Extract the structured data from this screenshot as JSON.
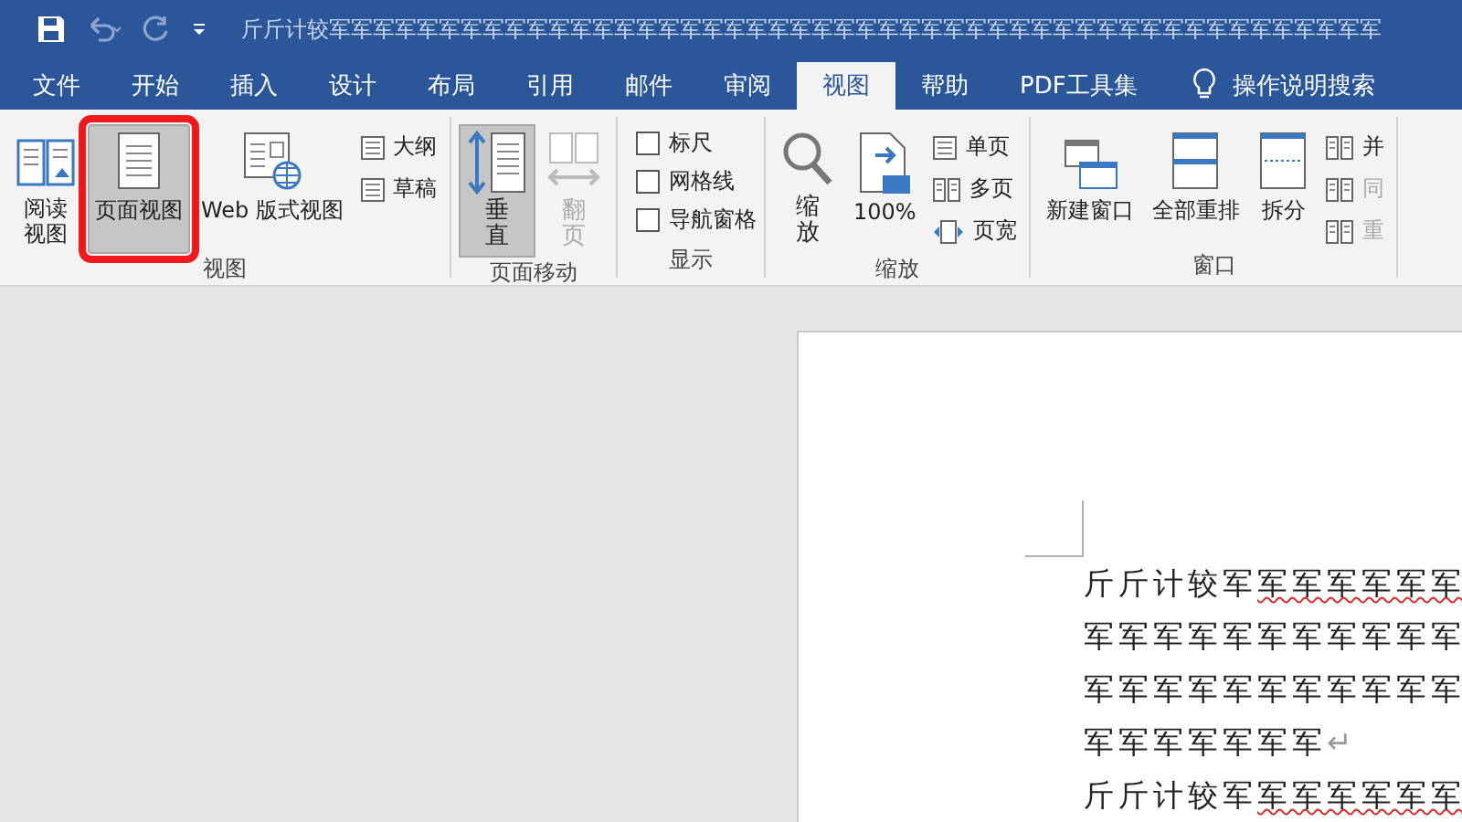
{
  "title_bar": {
    "title": "斤斤计较军军军军军军军军军军军军军军军军军军军军军军军军军军军军军军军军军军军军军军军军军军军军军军军军"
  },
  "tabs": [
    {
      "label": "文件",
      "selected": false
    },
    {
      "label": "开始",
      "selected": false
    },
    {
      "label": "插入",
      "selected": false
    },
    {
      "label": "设计",
      "selected": false
    },
    {
      "label": "布局",
      "selected": false
    },
    {
      "label": "引用",
      "selected": false
    },
    {
      "label": "邮件",
      "selected": false
    },
    {
      "label": "审阅",
      "selected": false
    },
    {
      "label": "视图",
      "selected": true
    },
    {
      "label": "帮助",
      "selected": false
    },
    {
      "label": "PDF工具集",
      "selected": false
    }
  ],
  "tell_me": {
    "label": "操作说明搜索"
  },
  "ribbon_groups": [
    {
      "label": "视图",
      "items": [
        {
          "kind": "large",
          "label": "阅读视图",
          "selected": false,
          "highlighted": false
        },
        {
          "kind": "large",
          "label": "页面视图",
          "selected": true,
          "highlighted": true
        },
        {
          "kind": "large",
          "label": "Web 版式视图",
          "selected": false,
          "highlighted": false
        },
        {
          "kind": "stack",
          "items": [
            {
              "label": "大纲",
              "disabled": false
            },
            {
              "label": "草稿",
              "disabled": false
            }
          ]
        }
      ]
    },
    {
      "label": "页面移动",
      "items": [
        {
          "kind": "tall",
          "label": "垂直",
          "selected": true,
          "disabled": false
        },
        {
          "kind": "tall",
          "label": "翻页",
          "selected": false,
          "disabled": true
        }
      ]
    },
    {
      "label": "显示",
      "items": [
        {
          "kind": "checks",
          "items": [
            {
              "label": "标尺",
              "checked": false
            },
            {
              "label": "网格线",
              "checked": false
            },
            {
              "label": "导航窗格",
              "checked": false
            }
          ]
        }
      ]
    },
    {
      "label": "缩放",
      "items": [
        {
          "kind": "tall",
          "label": "缩放",
          "selected": false,
          "disabled": false
        },
        {
          "kind": "large",
          "label": "100%",
          "selected": false,
          "highlighted": false
        },
        {
          "kind": "stack",
          "items": [
            {
              "label": "单页",
              "disabled": false
            },
            {
              "label": "多页",
              "disabled": false
            },
            {
              "label": "页宽",
              "disabled": false
            }
          ]
        }
      ]
    },
    {
      "label": "窗口",
      "items": [
        {
          "kind": "large",
          "label": "新建窗口",
          "selected": false,
          "highlighted": false
        },
        {
          "kind": "large",
          "label": "全部重排",
          "selected": false,
          "highlighted": false
        },
        {
          "kind": "large",
          "label": "拆分",
          "selected": false,
          "highlighted": false
        },
        {
          "kind": "stack",
          "items": [
            {
              "label": "并",
              "disabled": false
            },
            {
              "label": "同",
              "disabled": true
            },
            {
              "label": "重",
              "disabled": true
            }
          ]
        }
      ]
    }
  ],
  "document": {
    "lines": [
      {
        "text": "斤斤计较军",
        "flagged": "军军军军军军"
      },
      {
        "text": "军军军军军军军军军军军"
      },
      {
        "text": "军军军军军军军军军军军"
      },
      {
        "text": "军军军军军军军",
        "paragraph_mark": "↵"
      },
      {
        "text": "斤斤计较军",
        "flagged": "军军军军军军"
      }
    ]
  }
}
